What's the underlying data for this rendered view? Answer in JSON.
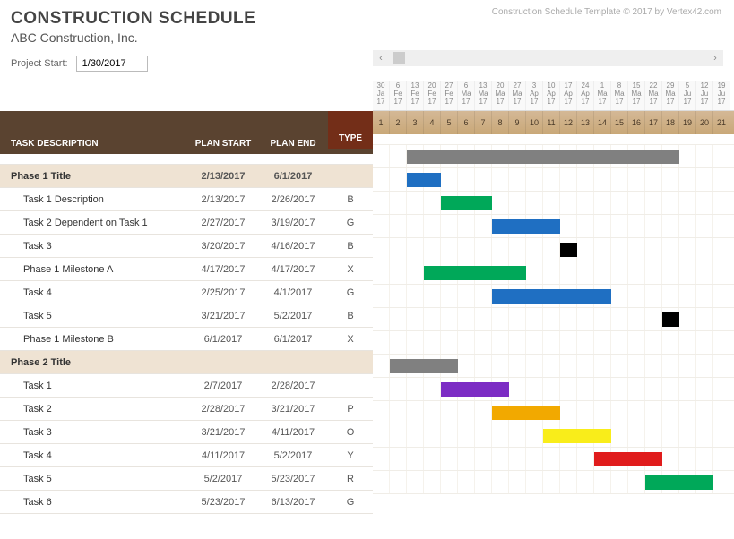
{
  "header": {
    "title": "CONSTRUCTION SCHEDULE",
    "subtitle": "ABC Construction, Inc.",
    "credit": "Construction Schedule Template © 2017 by Vertex42.com",
    "project_start_label": "Project Start:",
    "project_start_value": "1/30/2017"
  },
  "columns": {
    "task": "TASK DESCRIPTION",
    "plan_start": "PLAN START",
    "plan_end": "PLAN END",
    "type": "TYPE"
  },
  "date_headers": [
    {
      "d": "30",
      "m": "Ja",
      "y": "17"
    },
    {
      "d": "6",
      "m": "Fe",
      "y": "17"
    },
    {
      "d": "13",
      "m": "Fe",
      "y": "17"
    },
    {
      "d": "20",
      "m": "Fe",
      "y": "17"
    },
    {
      "d": "27",
      "m": "Fe",
      "y": "17"
    },
    {
      "d": "6",
      "m": "Ma",
      "y": "17"
    },
    {
      "d": "13",
      "m": "Ma",
      "y": "17"
    },
    {
      "d": "20",
      "m": "Ma",
      "y": "17"
    },
    {
      "d": "27",
      "m": "Ma",
      "y": "17"
    },
    {
      "d": "3",
      "m": "Ap",
      "y": "17"
    },
    {
      "d": "10",
      "m": "Ap",
      "y": "17"
    },
    {
      "d": "17",
      "m": "Ap",
      "y": "17"
    },
    {
      "d": "24",
      "m": "Ap",
      "y": "17"
    },
    {
      "d": "1",
      "m": "Ma",
      "y": "17"
    },
    {
      "d": "8",
      "m": "Ma",
      "y": "17"
    },
    {
      "d": "15",
      "m": "Ma",
      "y": "17"
    },
    {
      "d": "22",
      "m": "Ma",
      "y": "17"
    },
    {
      "d": "29",
      "m": "Ma",
      "y": "17"
    },
    {
      "d": "5",
      "m": "Ju",
      "y": "17"
    },
    {
      "d": "12",
      "m": "Ju",
      "y": "17"
    },
    {
      "d": "19",
      "m": "Ju",
      "y": "17"
    }
  ],
  "week_numbers": [
    "1",
    "2",
    "3",
    "4",
    "5",
    "6",
    "7",
    "8",
    "9",
    "10",
    "11",
    "12",
    "13",
    "14",
    "15",
    "16",
    "17",
    "18",
    "19",
    "20",
    "21"
  ],
  "rows": [
    {
      "kind": "phase",
      "task": "Phase 1 Title",
      "start": "2/13/2017",
      "end": "6/1/2017",
      "type": "",
      "bar": {
        "from": 3,
        "to": 18,
        "color": "#808080"
      }
    },
    {
      "kind": "task",
      "task": "Task 1 Description",
      "start": "2/13/2017",
      "end": "2/26/2017",
      "type": "B",
      "bar": {
        "from": 3,
        "to": 4,
        "color": "#1f6fc2"
      }
    },
    {
      "kind": "task",
      "task": "Task 2 Dependent on Task 1",
      "start": "2/27/2017",
      "end": "3/19/2017",
      "type": "G",
      "bar": {
        "from": 5,
        "to": 7,
        "color": "#00a859"
      }
    },
    {
      "kind": "task",
      "task": "Task 3",
      "start": "3/20/2017",
      "end": "4/16/2017",
      "type": "B",
      "bar": {
        "from": 8,
        "to": 11,
        "color": "#1f6fc2"
      }
    },
    {
      "kind": "task",
      "task": "Phase 1 Milestone A",
      "start": "4/17/2017",
      "end": "4/17/2017",
      "type": "X",
      "bar": {
        "from": 12,
        "to": 12,
        "color": "#000000"
      }
    },
    {
      "kind": "task",
      "task": "Task 4",
      "start": "2/25/2017",
      "end": "4/1/2017",
      "type": "G",
      "bar": {
        "from": 4,
        "to": 9,
        "color": "#00a859"
      }
    },
    {
      "kind": "task",
      "task": "Task 5",
      "start": "3/21/2017",
      "end": "5/2/2017",
      "type": "B",
      "bar": {
        "from": 8,
        "to": 14,
        "color": "#1f6fc2"
      }
    },
    {
      "kind": "task",
      "task": "Phase 1 Milestone B",
      "start": "6/1/2017",
      "end": "6/1/2017",
      "type": "X",
      "bar": {
        "from": 18,
        "to": 18,
        "color": "#000000"
      }
    },
    {
      "kind": "phase",
      "task": "Phase 2 Title",
      "start": "",
      "end": "",
      "type": ""
    },
    {
      "kind": "task",
      "task": "Task 1",
      "start": "2/7/2017",
      "end": "2/28/2017",
      "type": "",
      "bar": {
        "from": 2,
        "to": 5,
        "color": "#808080"
      }
    },
    {
      "kind": "task",
      "task": "Task 2",
      "start": "2/28/2017",
      "end": "3/21/2017",
      "type": "P",
      "bar": {
        "from": 5,
        "to": 8,
        "color": "#7c2cc4"
      }
    },
    {
      "kind": "task",
      "task": "Task 3",
      "start": "3/21/2017",
      "end": "4/11/2017",
      "type": "O",
      "bar": {
        "from": 8,
        "to": 11,
        "color": "#f2a900"
      }
    },
    {
      "kind": "task",
      "task": "Task 4",
      "start": "4/11/2017",
      "end": "5/2/2017",
      "type": "Y",
      "bar": {
        "from": 11,
        "to": 14,
        "color": "#f9ed1a"
      }
    },
    {
      "kind": "task",
      "task": "Task 5",
      "start": "5/2/2017",
      "end": "5/23/2017",
      "type": "R",
      "bar": {
        "from": 14,
        "to": 17,
        "color": "#e01c1c"
      }
    },
    {
      "kind": "task",
      "task": "Task 6",
      "start": "5/23/2017",
      "end": "6/13/2017",
      "type": "G",
      "bar": {
        "from": 17,
        "to": 20,
        "color": "#00a859"
      }
    }
  ],
  "chart_data": {
    "type": "gantt",
    "title": "Construction Schedule",
    "start_date": "1/30/2017",
    "week_labels": [
      "1",
      "2",
      "3",
      "4",
      "5",
      "6",
      "7",
      "8",
      "9",
      "10",
      "11",
      "12",
      "13",
      "14",
      "15",
      "16",
      "17",
      "18",
      "19",
      "20",
      "21"
    ],
    "week_start_dates": [
      "2017-01-30",
      "2017-02-06",
      "2017-02-13",
      "2017-02-20",
      "2017-02-27",
      "2017-03-06",
      "2017-03-13",
      "2017-03-20",
      "2017-03-27",
      "2017-04-03",
      "2017-04-10",
      "2017-04-17",
      "2017-04-24",
      "2017-05-01",
      "2017-05-08",
      "2017-05-15",
      "2017-05-22",
      "2017-05-29",
      "2017-06-05",
      "2017-06-12",
      "2017-06-19"
    ],
    "series": [
      {
        "name": "Phase 1 Title",
        "start": "2017-02-13",
        "end": "2017-06-01",
        "type": "phase",
        "color": "#808080"
      },
      {
        "name": "Task 1 Description",
        "start": "2017-02-13",
        "end": "2017-02-26",
        "type": "B",
        "color": "#1f6fc2"
      },
      {
        "name": "Task 2 Dependent on Task 1",
        "start": "2017-02-27",
        "end": "2017-03-19",
        "type": "G",
        "color": "#00a859"
      },
      {
        "name": "Task 3",
        "start": "2017-03-20",
        "end": "2017-04-16",
        "type": "B",
        "color": "#1f6fc2"
      },
      {
        "name": "Phase 1 Milestone A",
        "start": "2017-04-17",
        "end": "2017-04-17",
        "type": "X",
        "color": "#000000"
      },
      {
        "name": "Task 4",
        "start": "2017-02-25",
        "end": "2017-04-01",
        "type": "G",
        "color": "#00a859"
      },
      {
        "name": "Task 5",
        "start": "2017-03-21",
        "end": "2017-05-02",
        "type": "B",
        "color": "#1f6fc2"
      },
      {
        "name": "Phase 1 Milestone B",
        "start": "2017-06-01",
        "end": "2017-06-01",
        "type": "X",
        "color": "#000000"
      },
      {
        "name": "Phase 2 Title",
        "start": "",
        "end": "",
        "type": "phase"
      },
      {
        "name": "Task 1",
        "start": "2017-02-07",
        "end": "2017-02-28",
        "type": "",
        "color": "#808080"
      },
      {
        "name": "Task 2",
        "start": "2017-02-28",
        "end": "2017-03-21",
        "type": "P",
        "color": "#7c2cc4"
      },
      {
        "name": "Task 3",
        "start": "2017-03-21",
        "end": "2017-04-11",
        "type": "O",
        "color": "#f2a900"
      },
      {
        "name": "Task 4",
        "start": "2017-04-11",
        "end": "2017-05-02",
        "type": "Y",
        "color": "#f9ed1a"
      },
      {
        "name": "Task 5",
        "start": "2017-05-02",
        "end": "2017-05-23",
        "type": "R",
        "color": "#e01c1c"
      },
      {
        "name": "Task 6",
        "start": "2017-05-23",
        "end": "2017-06-13",
        "type": "G",
        "color": "#00a859"
      }
    ]
  }
}
